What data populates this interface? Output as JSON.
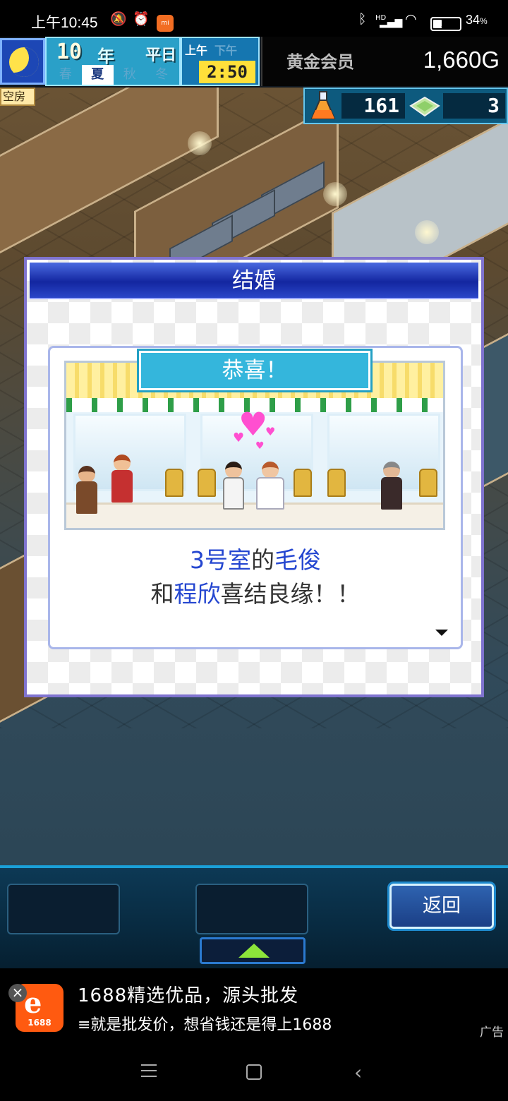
{
  "status_bar": {
    "time": "上午10:45",
    "battery_percent": "34",
    "battery_suffix": "%",
    "battery_level": 0.34,
    "network": "HD",
    "icons": [
      "mute-icon",
      "alarm-icon",
      "mi-app-icon",
      "bluetooth-icon",
      "signal-icon",
      "wifi-icon",
      "battery-charging-icon"
    ]
  },
  "hud": {
    "year_number": "10",
    "year_unit": "年",
    "day_label": "平日",
    "seasons": [
      "春",
      "夏",
      "秋",
      "冬"
    ],
    "active_season": "夏",
    "am_label": "上午",
    "pm_label": "下午",
    "active_period": "上午",
    "clock": "2:50",
    "gold_label": "黄金会员",
    "gold_value": "1,660G",
    "research_points": "161",
    "tickets": "3",
    "room_tag": "空房"
  },
  "dialog": {
    "title": "结婚",
    "banner": "恭喜！",
    "line1": {
      "room": "3号室",
      "particle": "的",
      "name": "毛俊"
    },
    "line2": {
      "prefix": "和",
      "name": "程欣",
      "suffix": "喜结良缘！！"
    }
  },
  "bottom_panel": {
    "back_label": "返回"
  },
  "ad": {
    "logo_text": "1688",
    "title": "1688精选优品，源头批发",
    "subtitle": "≡就是批发价，想省钱还是得上1688",
    "tag": "广告"
  },
  "colors": {
    "dialog_title_bar": "#1326a0",
    "highlight_text": "#2446d0",
    "banner": "#34b6dc",
    "hud_gold_bg": "#050505",
    "ad_logo": "#ff5a10"
  }
}
